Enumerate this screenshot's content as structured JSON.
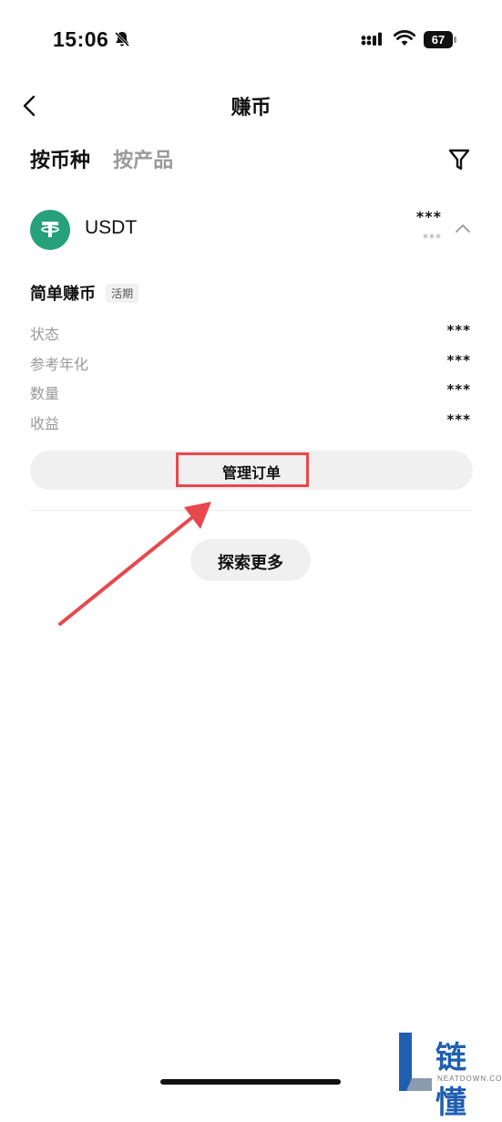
{
  "status_bar": {
    "time": "15:06",
    "battery": "67"
  },
  "header": {
    "title": "赚币"
  },
  "tabs": [
    {
      "label": "按币种",
      "active": true
    },
    {
      "label": "按产品",
      "active": false
    }
  ],
  "coin": {
    "symbol": "USDT",
    "amount": "***",
    "sub_amount": "***",
    "logo_color": "#26a17b"
  },
  "product": {
    "name": "简单赚币",
    "badge": "活期",
    "rows": [
      {
        "label": "状态",
        "value": "***"
      },
      {
        "label": "参考年化",
        "value": "***"
      },
      {
        "label": "数量",
        "value": "***"
      },
      {
        "label": "收益",
        "value": "***"
      }
    ]
  },
  "actions": {
    "manage_label": "管理订单",
    "explore_label": "探索更多"
  },
  "annotation": {
    "color": "#e8484d"
  },
  "watermark": {
    "text": "链懂",
    "sub": "NEATDOWN.COM"
  }
}
